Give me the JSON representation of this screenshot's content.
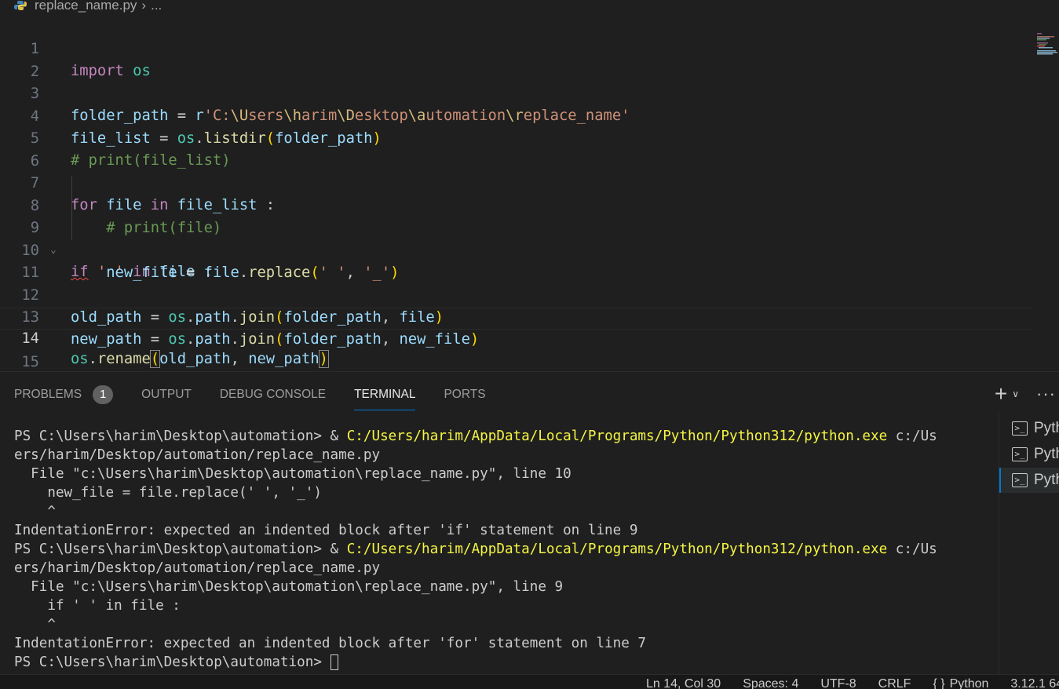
{
  "breadcrumb": {
    "file": "replace_name.py",
    "ellipsis": "..."
  },
  "editor": {
    "active_line": 14,
    "line_numbers": [
      "1",
      "2",
      "3",
      "4",
      "5",
      "6",
      "7",
      "8",
      "9",
      "10",
      "11",
      "12",
      "13",
      "14",
      "15"
    ]
  },
  "panel": {
    "tabs": {
      "problems": "PROBLEMS",
      "problems_count": "1",
      "output": "OUTPUT",
      "debug_console": "DEBUG CONSOLE",
      "terminal": "TERMINAL",
      "ports": "PORTS"
    },
    "terminal_lines": [
      {
        "prompt": "PS C:\\Users\\harim\\Desktop\\automation> & ",
        "path": "C:/Users/harim/AppData/Local/Programs/Python/Python312/python.exe",
        "rest": " c:/Us"
      },
      {
        "text": "ers/harim/Desktop/automation/replace_name.py"
      },
      {
        "text": "  File \"c:\\Users\\harim\\Desktop\\automation\\replace_name.py\", line 10"
      },
      {
        "text": "    new_file = file.replace(' ', '_')"
      },
      {
        "text": "    ^"
      },
      {
        "text": "IndentationError: expected an indented block after 'if' statement on line 9"
      },
      {
        "prompt": "PS C:\\Users\\harim\\Desktop\\automation> & ",
        "path": "C:/Users/harim/AppData/Local/Programs/Python/Python312/python.exe",
        "rest": " c:/Us"
      },
      {
        "text": "ers/harim/Desktop/automation/replace_name.py"
      },
      {
        "text": "  File \"c:\\Users\\harim\\Desktop\\automation\\replace_name.py\", line 9"
      },
      {
        "text": "    if ' ' in file :"
      },
      {
        "text": "    ^"
      },
      {
        "text": "IndentationError: expected an indented block after 'for' statement on line 7"
      },
      {
        "text": "PS C:\\Users\\harim\\Desktop\\automation> "
      }
    ],
    "terminal_list": [
      "Pyth",
      "Pyth",
      "Pyth"
    ]
  },
  "statusbar": {
    "position": "Ln 14, Col 30",
    "spaces": "Spaces: 4",
    "encoding": "UTF-8",
    "eol": "CRLF",
    "language": "Python",
    "version": "3.12.1 64"
  }
}
